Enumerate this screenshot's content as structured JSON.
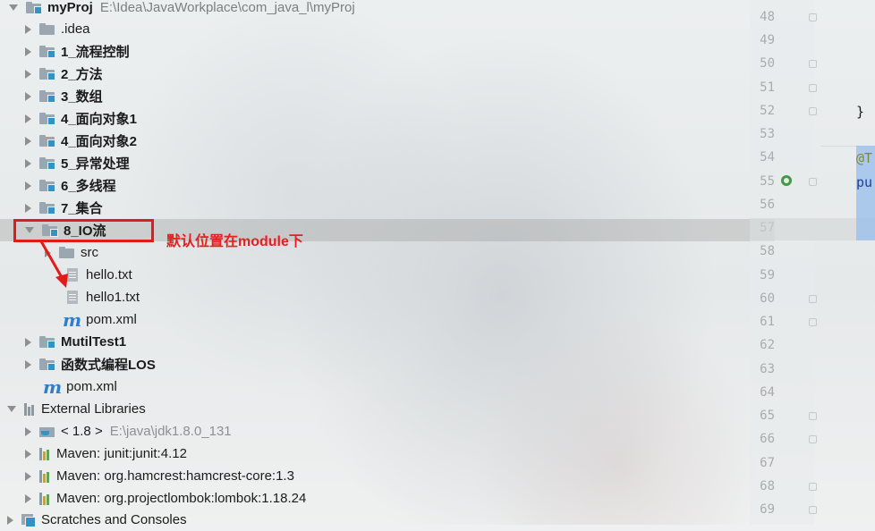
{
  "tree": {
    "project": {
      "name": "myProj",
      "path": "E:\\Idea\\JavaWorkplace\\com_java_l\\myProj"
    },
    "items": [
      {
        "label": ".idea"
      },
      {
        "label": "1_流程控制"
      },
      {
        "label": "2_方法"
      },
      {
        "label": "3_数组"
      },
      {
        "label": "4_面向对象1"
      },
      {
        "label": "4_面向对象2"
      },
      {
        "label": "5_异常处理"
      },
      {
        "label": "6_多线程"
      },
      {
        "label": "7_集合"
      },
      {
        "label": "8_IO流"
      },
      {
        "label": "src"
      },
      {
        "label": "hello.txt"
      },
      {
        "label": "hello1.txt"
      },
      {
        "label": "pom.xml"
      },
      {
        "label": "MutilTest1"
      },
      {
        "label": "函数式编程LOS"
      },
      {
        "label": "pom.xml"
      }
    ],
    "external_libraries": {
      "label": "External Libraries",
      "jdk": {
        "label": "< 1.8 >",
        "path": "E:\\java\\jdk1.8.0_131"
      },
      "libs": [
        {
          "label": "Maven: junit:junit:4.12"
        },
        {
          "label": "Maven: org.hamcrest:hamcrest-core:1.3"
        },
        {
          "label": "Maven: org.projectlombok:lombok:1.18.24"
        }
      ]
    },
    "scratches": {
      "label": "Scratches and Consoles"
    }
  },
  "annotation": {
    "text": "默认位置在module下",
    "color": "#e11a1a"
  },
  "editor": {
    "line_numbers": [
      "48",
      "49",
      "50",
      "51",
      "52",
      "53",
      "54",
      "55",
      "56",
      "57",
      "58",
      "59",
      "60",
      "61",
      "62",
      "63",
      "64",
      "65",
      "66",
      "67",
      "68",
      "69"
    ],
    "code": {
      "brace": "}",
      "annotation": "@T",
      "keyword": "pu"
    }
  },
  "colors": {
    "module_marker": "#3592c4",
    "selection": "#96bee b",
    "annotation_red": "#e11a1a"
  }
}
